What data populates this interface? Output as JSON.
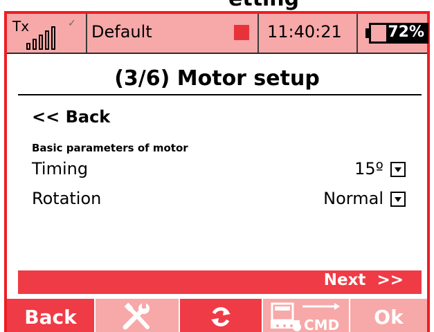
{
  "header_partial_text": "etting",
  "status_bar": {
    "tx_label": "Tx",
    "tx_icon": "signal-bars-icon",
    "model_name": "Default",
    "record_indicator_color": "#e8323a",
    "time": "11:40:21",
    "battery_percent": "72%",
    "battery_level": 0.72
  },
  "page": {
    "title": "(3/6) Motor setup",
    "back_label": "<< Back",
    "section_label": "Basic parameters of motor",
    "fields": [
      {
        "label": "Timing",
        "value": "15º"
      },
      {
        "label": "Rotation",
        "value": "Normal"
      }
    ],
    "next_label": "Next  >>"
  },
  "softkeys": [
    {
      "label": "Back",
      "icon": ""
    },
    {
      "label": "",
      "icon": "tools-icon"
    },
    {
      "label": "",
      "icon": "refresh-icon"
    },
    {
      "label": "CMD",
      "icon": "cmd-icon"
    },
    {
      "label": "Ok",
      "icon": ""
    }
  ],
  "colors": {
    "accent": "#ef3b46",
    "accent_light": "#f7a8a8",
    "frame": "#ef1c24"
  }
}
